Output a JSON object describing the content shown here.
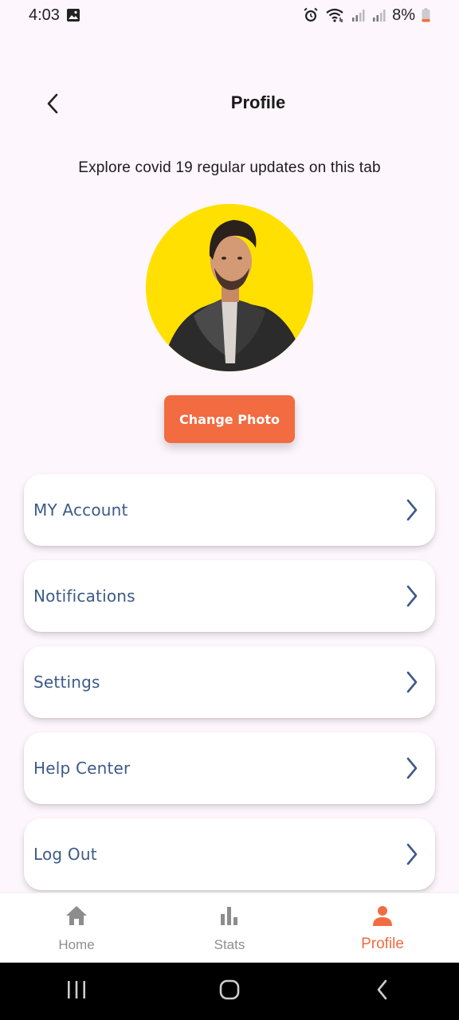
{
  "status_bar": {
    "time": "4:03",
    "battery": "8%",
    "icons": [
      "image-icon",
      "alarm-icon",
      "wifi-icon",
      "signal-icon",
      "signal-icon",
      "battery-icon"
    ]
  },
  "header": {
    "title": "Profile",
    "back_icon": "back-arrow-icon"
  },
  "subtitle": "Explore covid 19 regular updates on this tab",
  "avatar": {
    "background": "#ffe000"
  },
  "change_photo_label": "Change Photo",
  "menu": {
    "items": [
      {
        "label": "MY Account",
        "icon": "chevron-right-icon"
      },
      {
        "label": "Notifications",
        "icon": "chevron-right-icon"
      },
      {
        "label": "Settings",
        "icon": "chevron-right-icon"
      },
      {
        "label": "Help Center",
        "icon": "chevron-right-icon"
      },
      {
        "label": "Log Out",
        "icon": "chevron-right-icon"
      }
    ]
  },
  "bottom_nav": {
    "items": [
      {
        "label": "Home",
        "icon": "home-icon",
        "active": false
      },
      {
        "label": "Stats",
        "icon": "stats-icon",
        "active": false
      },
      {
        "label": "Profile",
        "icon": "person-icon",
        "active": true
      }
    ]
  },
  "colors": {
    "accent": "#f26b41",
    "menu_text": "#3d5a87",
    "background": "#fdf6fc",
    "inactive_nav": "#8d8d8d"
  }
}
